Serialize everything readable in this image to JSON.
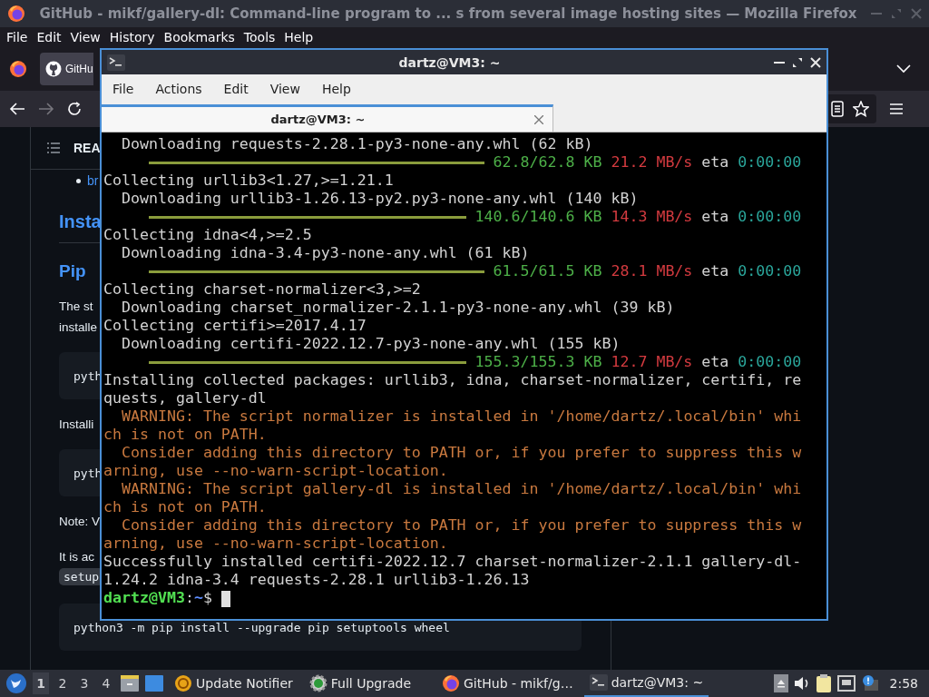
{
  "browser": {
    "title": "GitHub - mikf/gallery-dl: Command-line program to ... s from several image hosting sites — Mozilla Firefox",
    "menu": [
      "File",
      "Edit",
      "View",
      "History",
      "Bookmarks",
      "Tools",
      "Help"
    ],
    "tab": {
      "label": "GitHu"
    },
    "page": {
      "toc_label": "REA",
      "bullet": "br",
      "heading": "Insta",
      "subheading": "Pip",
      "paragraph1": [
        "The st",
        "installe"
      ],
      "code1": "pyth",
      "paragraph2": "Installi",
      "code2": "pyth",
      "note": "Note: V",
      "paragraph3": "It is ac",
      "inline_code": "setup",
      "code3": "python3 -m pip install --upgrade pip setuptools wheel"
    }
  },
  "terminal": {
    "title": "dartz@VM3: ~",
    "menu": [
      "File",
      "Actions",
      "Edit",
      "View",
      "Help"
    ],
    "tab": {
      "label": "dartz@VM3: ~"
    },
    "lines": [
      {
        "kind": "text",
        "text": "  Downloading requests-2.28.1-py3-none-any.whl (62 kB)"
      },
      {
        "kind": "progress",
        "level": 1,
        "amount": "62.8/62.8 KB",
        "rate": "21.2 MB/s",
        "eta_label": "eta",
        "eta": "0:00:00"
      },
      {
        "kind": "text",
        "text": "Collecting urllib3<1.27,>=1.21.1"
      },
      {
        "kind": "text",
        "text": "  Downloading urllib3-1.26.13-py2.py3-none-any.whl (140 kB)"
      },
      {
        "kind": "progress",
        "level": 1,
        "amount": "140.6/140.6 KB",
        "rate": "14.3 MB/s",
        "eta_label": "eta",
        "eta": "0:00:00"
      },
      {
        "kind": "text",
        "text": "Collecting idna<4,>=2.5"
      },
      {
        "kind": "text",
        "text": "  Downloading idna-3.4-py3-none-any.whl (61 kB)"
      },
      {
        "kind": "progress",
        "level": 1,
        "amount": "61.5/61.5 KB",
        "rate": "28.1 MB/s",
        "eta_label": "eta",
        "eta": "0:00:00"
      },
      {
        "kind": "text",
        "text": "Collecting charset-normalizer<3,>=2"
      },
      {
        "kind": "text",
        "text": "  Downloading charset_normalizer-2.1.1-py3-none-any.whl (39 kB)"
      },
      {
        "kind": "text",
        "text": "Collecting certifi>=2017.4.17"
      },
      {
        "kind": "text",
        "text": "  Downloading certifi-2022.12.7-py3-none-any.whl (155 kB)"
      },
      {
        "kind": "progress",
        "level": 1,
        "amount": "155.3/155.3 KB",
        "rate": "12.7 MB/s",
        "eta_label": "eta",
        "eta": "0:00:00"
      },
      {
        "kind": "text",
        "text": "Installing collected packages: urllib3, idna, charset-normalizer, certifi, re"
      },
      {
        "kind": "text",
        "text": "quests, gallery-dl"
      },
      {
        "kind": "warning",
        "text": "  WARNING: The script normalizer is installed in '/home/dartz/.local/bin' whi"
      },
      {
        "kind": "warning",
        "text": "ch is not on PATH."
      },
      {
        "kind": "warning",
        "text": "  Consider adding this directory to PATH or, if you prefer to suppress this w"
      },
      {
        "kind": "warning",
        "text": "arning, use --no-warn-script-location."
      },
      {
        "kind": "warning",
        "text": "  WARNING: The script gallery-dl is installed in '/home/dartz/.local/bin' whi"
      },
      {
        "kind": "warning",
        "text": "ch is not on PATH."
      },
      {
        "kind": "warning",
        "text": "  Consider adding this directory to PATH or, if you prefer to suppress this w"
      },
      {
        "kind": "warning",
        "text": "arning, use --no-warn-script-location."
      },
      {
        "kind": "text",
        "text": "Successfully installed certifi-2022.12.7 charset-normalizer-2.1.1 gallery-dl-"
      },
      {
        "kind": "text",
        "text": "1.24.2 idna-3.4 requests-2.28.1 urllib3-1.26.13"
      },
      {
        "kind": "prompt",
        "user": "dartz@VM3",
        "sep": ":",
        "path": "~",
        "symbol": "$"
      }
    ]
  },
  "taskbar": {
    "workspaces": [
      {
        "label": "1",
        "selected": true
      },
      {
        "label": "2",
        "selected": false
      },
      {
        "label": "3",
        "selected": false
      },
      {
        "label": "4",
        "selected": false
      }
    ],
    "launchers": [
      {
        "kind": "update",
        "label": "Update Notifier"
      },
      {
        "kind": "upgrade",
        "label": "Full Upgrade"
      }
    ],
    "tasks": [
      {
        "kind": "firefox",
        "label": "GitHub - mikf/g…",
        "selected": false
      },
      {
        "kind": "terminal",
        "label": "dartz@VM3: ~",
        "selected": true
      }
    ],
    "clock": "2:58"
  }
}
